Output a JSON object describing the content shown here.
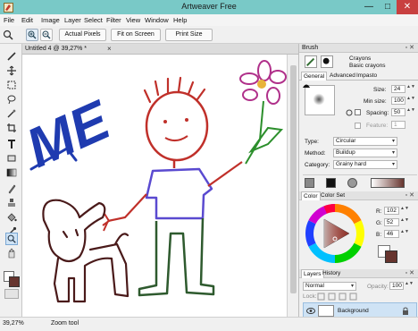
{
  "window": {
    "title": "Artweaver Free",
    "minimize_glyph": "—",
    "maximize_glyph": "□",
    "close_glyph": "✕"
  },
  "menu": [
    "File",
    "Edit",
    "Image",
    "Layer",
    "Select",
    "Filter",
    "View",
    "Window",
    "Help"
  ],
  "options_bar": {
    "actual_pixels": "Actual Pixels",
    "fit_on_screen": "Fit on Screen",
    "print_size": "Print Size"
  },
  "document": {
    "tab_label": "Untitled 4 @ 39,27% *",
    "tab_close": "×"
  },
  "canvas_text": {
    "me": "ME"
  },
  "status": {
    "zoom": "39,27%",
    "tool": "Zoom tool"
  },
  "brush_panel": {
    "title": "Brush",
    "category_name": "Crayons",
    "variant_name": "Basic crayons",
    "tabs": [
      "General",
      "Advanced",
      "Impasto"
    ],
    "size_label": "Size:",
    "size_value": "24",
    "min_size_label": "Min size:",
    "min_size_value": "100",
    "spacing_label": "Spacing:",
    "spacing_value": "50",
    "feature_label": "Feature:",
    "feature_value": "1",
    "type_label": "Type:",
    "type_value": "Circular",
    "method_label": "Method:",
    "method_value": "Buildup",
    "category_label": "Category:",
    "category_value": "Grainy hard"
  },
  "color_panel": {
    "tabs": [
      "Color",
      "Color Set"
    ],
    "r_label": "R:",
    "r_value": "102",
    "g_label": "G:",
    "g_value": "52",
    "b_label": "B:",
    "b_value": "46",
    "foreground": "#66342e",
    "background": "#ffffff"
  },
  "layers_panel": {
    "tabs": [
      "Layers",
      "History"
    ],
    "blend_mode": "Normal",
    "opacity_label": "Opacity:",
    "opacity_value": "100",
    "lock_label": "Lock:",
    "layer_name": "Background"
  },
  "colors": {
    "titlebar": "#79c9c7",
    "close": "#c84040",
    "accent": "#cfe3f5"
  }
}
